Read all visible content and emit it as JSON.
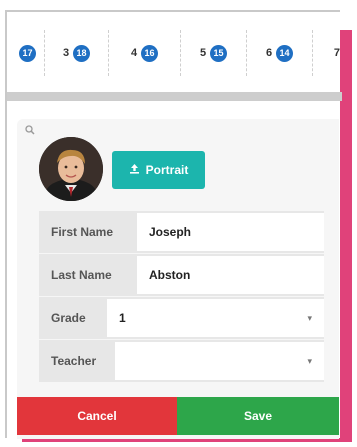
{
  "timeline": {
    "items": [
      {
        "label": "",
        "badge": "17"
      },
      {
        "label": "3",
        "badge": "18"
      },
      {
        "label": "4",
        "badge": "16"
      },
      {
        "label": "5",
        "badge": "15"
      },
      {
        "label": "6",
        "badge": "14"
      },
      {
        "label": "7",
        "badge": ""
      }
    ]
  },
  "profile": {
    "portrait_button_label": "Portrait"
  },
  "form": {
    "first_name_label": "First Name",
    "first_name_value": "Joseph",
    "last_name_label": "Last Name",
    "last_name_value": "Abston",
    "grade_label": "Grade",
    "grade_value": "1",
    "teacher_label": "Teacher",
    "teacher_value": ""
  },
  "actions": {
    "cancel_label": "Cancel",
    "save_label": "Save"
  },
  "colors": {
    "accent_pink": "#e0427a",
    "badge_blue": "#1f6fc3",
    "portrait_teal": "#1cb5ad",
    "cancel_red": "#e2363b",
    "save_green": "#2da64a"
  },
  "icons": {
    "zoom": "magnifier-icon",
    "upload": "upload-icon",
    "dropdown": "chevron-down-icon"
  }
}
